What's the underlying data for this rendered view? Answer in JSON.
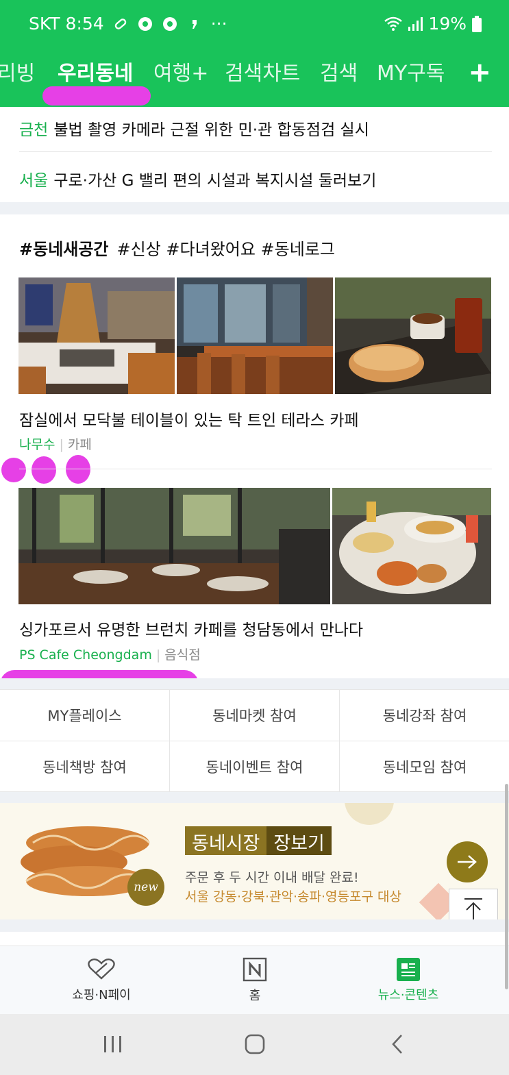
{
  "status_bar": {
    "carrier_time": "SKT 8:54",
    "more": "···",
    "battery": "19%"
  },
  "tabs": [
    {
      "label": "리빙"
    },
    {
      "label": "우리동네"
    },
    {
      "label": "여행+"
    },
    {
      "label": "검색차트"
    },
    {
      "label": "검색"
    },
    {
      "label": "MY구독"
    }
  ],
  "headlines": [
    {
      "region": "금천",
      "text": "불법 촬영 카메라 근절 위한 민·관 합동점검 실시"
    },
    {
      "region": "서울",
      "text": "구로·가산 G 밸리 편의 시설과 복지시설 둘러보기"
    }
  ],
  "section": {
    "main_tag": "#동네새공간",
    "tags": "#신상 #다녀왔어요 #동네로그"
  },
  "cards": [
    {
      "caption": "잠실에서 모닥불 테이블이 있는 탁 트인 테라스 카페",
      "source": "나무수",
      "category": "카페"
    },
    {
      "caption": "싱가포르서 유명한 브런치 카페를 청담동에서 만나다",
      "source": "PS Cafe Cheongdam",
      "category": "음식점"
    }
  ],
  "grid_buttons": [
    "MY플레이스",
    "동네마켓 참여",
    "동네강좌 참여",
    "동네책방 참여",
    "동네이벤트 참여",
    "동네모임 참여"
  ],
  "banner": {
    "title_part1": "동네시장",
    "title_part2": "장보기",
    "line1": "주문 후 두 시간 이내 배달 완료!",
    "line2": "서울 강동·강북·관악·송파·영등포구 대상",
    "badge": "new"
  },
  "bottom_nav": [
    {
      "label": "쇼핑·N페이",
      "icon": "heart-tag-icon"
    },
    {
      "label": "홈",
      "icon": "n-logo-icon"
    },
    {
      "label": "뉴스·콘텐츠",
      "icon": "news-icon"
    }
  ],
  "colors": {
    "brand_green": "#19c35a",
    "highlight_green": "#19b04e",
    "banner_gold": "#8b7422"
  }
}
